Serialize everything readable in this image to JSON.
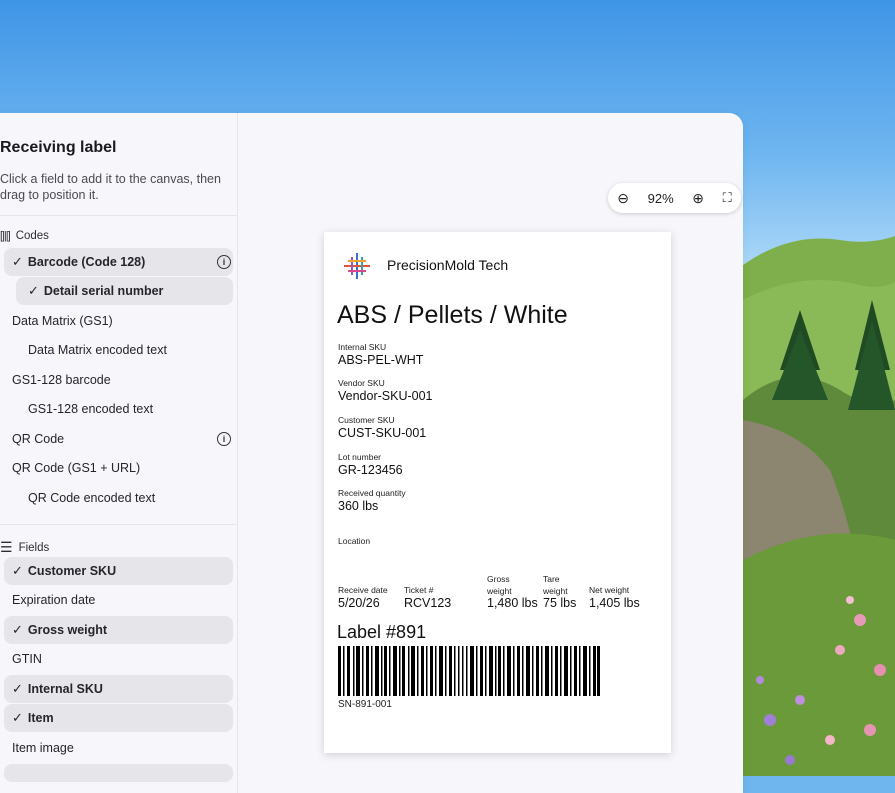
{
  "panel": {
    "title": "Receiving label",
    "hint": "Click a field to add it to the canvas, then drag to position it."
  },
  "sections": {
    "codes_label": "Codes",
    "fields_label": "Fields"
  },
  "codes_items": [
    {
      "label": "Barcode (Code 128)",
      "selected": true,
      "info": true
    },
    {
      "label": "Detail serial number",
      "selected": true,
      "sub": true
    },
    {
      "label": "Data Matrix (GS1)",
      "selected": false
    },
    {
      "label": "Data Matrix encoded text",
      "selected": false,
      "sub": true
    },
    {
      "label": "GS1-128 barcode",
      "selected": false
    },
    {
      "label": "GS1-128 encoded text",
      "selected": false,
      "sub": true
    },
    {
      "label": "QR Code",
      "selected": false,
      "info": true
    },
    {
      "label": "QR Code (GS1 + URL)",
      "selected": false
    },
    {
      "label": "QR Code encoded text",
      "selected": false,
      "sub": true
    }
  ],
  "field_items": [
    {
      "label": "Customer SKU",
      "selected": true
    },
    {
      "label": "Expiration date",
      "selected": false
    },
    {
      "label": "Gross weight",
      "selected": true
    },
    {
      "label": "GTIN",
      "selected": false
    },
    {
      "label": "Internal SKU",
      "selected": true
    },
    {
      "label": "Item",
      "selected": true
    },
    {
      "label": "Item image",
      "selected": false
    }
  ],
  "zoom": {
    "value": "92%"
  },
  "label": {
    "company": "PrecisionMold Tech",
    "item": "ABS / Pellets / White",
    "internal_sku_label": "Internal SKU",
    "internal_sku": "ABS-PEL-WHT",
    "vendor_sku_label": "Vendor SKU",
    "vendor_sku": "Vendor-SKU-001",
    "customer_sku_label": "Customer SKU",
    "customer_sku": "CUST-SKU-001",
    "lot_label": "Lot number",
    "lot": "GR-123456",
    "qty_label": "Received quantity",
    "qty": "360 lbs",
    "location_label": "Location",
    "receive_date_label": "Receive date",
    "receive_date": "5/20/26",
    "ticket_label": "Ticket #",
    "ticket": "RCV123",
    "gross_label": "Gross weight",
    "gross": "1,480 lbs",
    "tare_label": "Tare weight",
    "tare": "75 lbs",
    "net_label": "Net weight",
    "net": "1,405 lbs",
    "label_number": "Label #891",
    "serial": "SN-891-001"
  }
}
